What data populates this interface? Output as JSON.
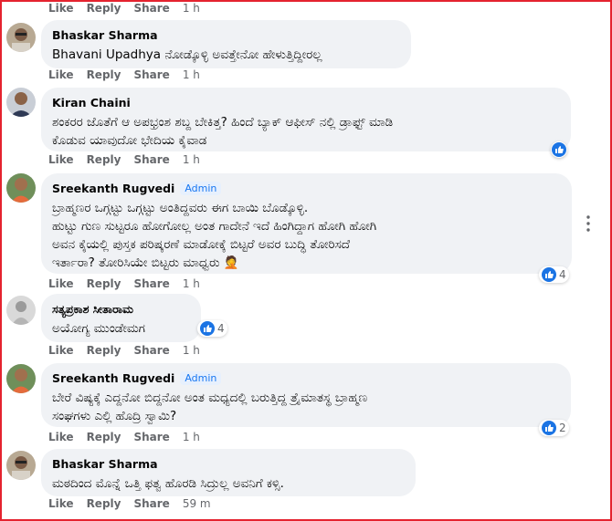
{
  "actions": {
    "like": "Like",
    "reply": "Reply",
    "share": "Share"
  },
  "comments": [
    {
      "time": "1 h"
    },
    {
      "name": "Bhaskar Sharma",
      "mention": "Bhavani Upadhya",
      "text": " ನೋಡ್ಕೊಳ್ಳಿ ಅವತ್ತೇನೋ ಹೇಳುತ್ತಿದ್ದೀರಲ್ಲ",
      "time": "1 h"
    },
    {
      "name": "Kiran Chaini",
      "text": "ಶಂಕರರ ಜೊತೆಗೆ ಆ ಅಪಭ್ರಂಶ ಶಬ್ದ ಬೇಕಿತ್ತ? ಹಿಂದೆ ಬ್ಯಾಕ್ ಆಫೀಸ್ ನಲ್ಲಿ ಡ್ರಾಫ್ಟ್ ಮಾಡಿ\nಕೊಡುವ ಯಾವುದೋ ಭೇದಿಯ ಕೈವಾಡ",
      "time": "1 h"
    },
    {
      "name": "Sreekanth Rugvedi",
      "badge": "Admin",
      "text": "ಬ್ರಾಹ್ಮಣರ ಒಗ್ಗಟ್ಟು ಒಗ್ಗಟ್ಟು ಅಂತಿದ್ದವರು ಈಗ ಬಾಯಿ ಬೊಡ್ಕೊಳ್ಳಿ.\nಹುಟ್ಟು ಗುಣ ಸುಟ್ಟರೂ ಹೋಗೋಲ್ಲ ಅಂತ ಗಾದೇನೆ ಇದೆ ಹಿಂಗಿದ್ದಾಗ ಹೋಗಿ ಹೋಗಿ\nಅವನ ಕೈಯಲ್ಲಿ ಪುಸ್ತಕ ಪರಿಷ್ಕರಣೆ ಮಾಡೋಕ್ಕೆ ಬಿಟ್ಟರೆ ಅವರ ಬುದ್ಧಿ ತೋರಿಸದೆ\nಇರ್ತಾರಾ? ತೋರಿಸಿಯೇ ಬಿಟ್ಟರು ಮಾಧ್ವರು 🤦",
      "time": "1 h",
      "reactions": "4"
    },
    {
      "name": "ಸತ್ಯಪ್ರಕಾಶ ಸೀತಾರಾಮ",
      "text": "ಅಯೋಗ್ಯ ಮುಂಡೇಮಗ",
      "time": "1 h",
      "reactions": "4"
    },
    {
      "name": "Sreekanth Rugvedi",
      "badge": "Admin",
      "text": "ಬೇರೆ ವಿಷ್ಯಕ್ಕೆ ಎದ್ದನೋ ಬಿದ್ದನೋ ಅಂತ ಮಧ್ಯದಲ್ಲಿ ಬರುತ್ತಿದ್ದ ತ್ರೈಮಾತಸ್ಥ ಬ್ರಾಹ್ಮಣ\nಸಂಘಗಳು ಎಲ್ಲಿ ಹೊದ್ರಿ ಸ್ವಾಮಿ?",
      "time": "1 h",
      "reactions": "2"
    },
    {
      "name": "Bhaskar Sharma",
      "text": "ಮಠದಿಂದ ಮೊನ್ನೆ ಒತ್ತಿ ಫತ್ವ ಹೊರಡಿ ಸಿದ್ರುಲ್ಲ ಅವನಿಗೆ ಕಳ್ಸಿ.",
      "time": "59 m"
    }
  ],
  "colors": {
    "frame": "#e4232f",
    "bubble": "#f0f2f5",
    "like_blue": "#1b74e4",
    "admin": "#1877f2"
  }
}
